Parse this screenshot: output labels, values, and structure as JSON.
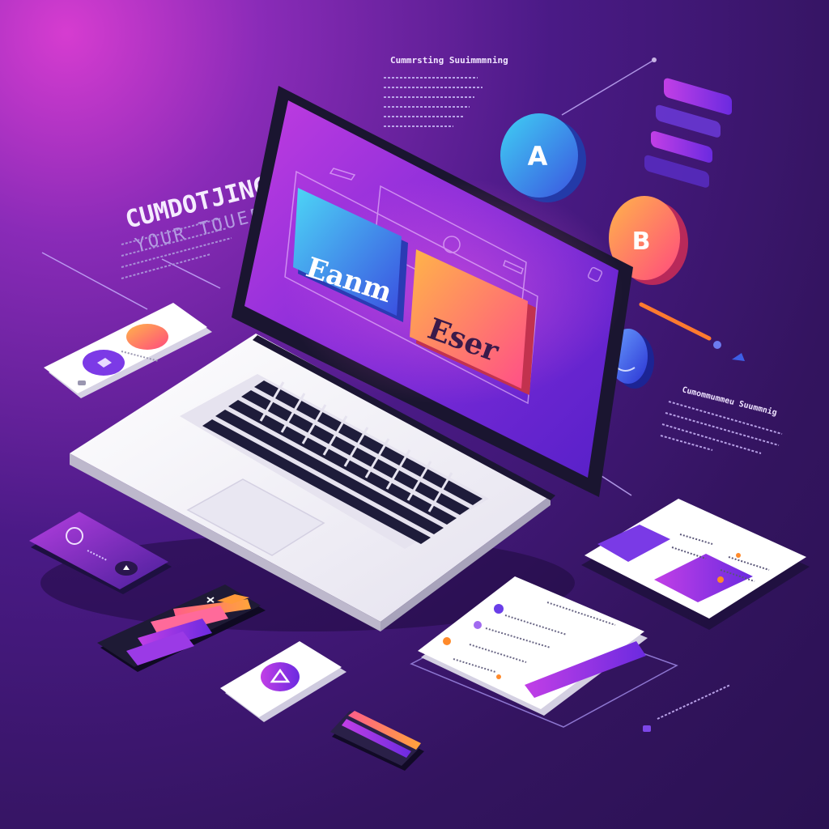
{
  "headline": {
    "title": "CUMDOTJING",
    "subtitle": "YOUR TOUEF"
  },
  "top_caption": "Cummrsting Suuimmmning",
  "right_caption": "Cumommummeu Suummnig",
  "screen": {
    "card_left_label": "Eanm",
    "card_right_label": "Eser"
  },
  "bubbles": [
    {
      "label": "A",
      "colors": [
        "#35c9f2",
        "#3d5de0"
      ]
    },
    {
      "label": "B",
      "colors": [
        "#ffb04a",
        "#ff4f7a"
      ]
    },
    {
      "label": "",
      "colors": [
        "#5c8bff",
        "#2a3ad8"
      ]
    }
  ],
  "colors": {
    "accent_purple": "#8a3bea",
    "accent_orange": "#ff7a2f",
    "accent_magenta": "#d73cd6",
    "accent_cyan": "#3cc7f4"
  }
}
